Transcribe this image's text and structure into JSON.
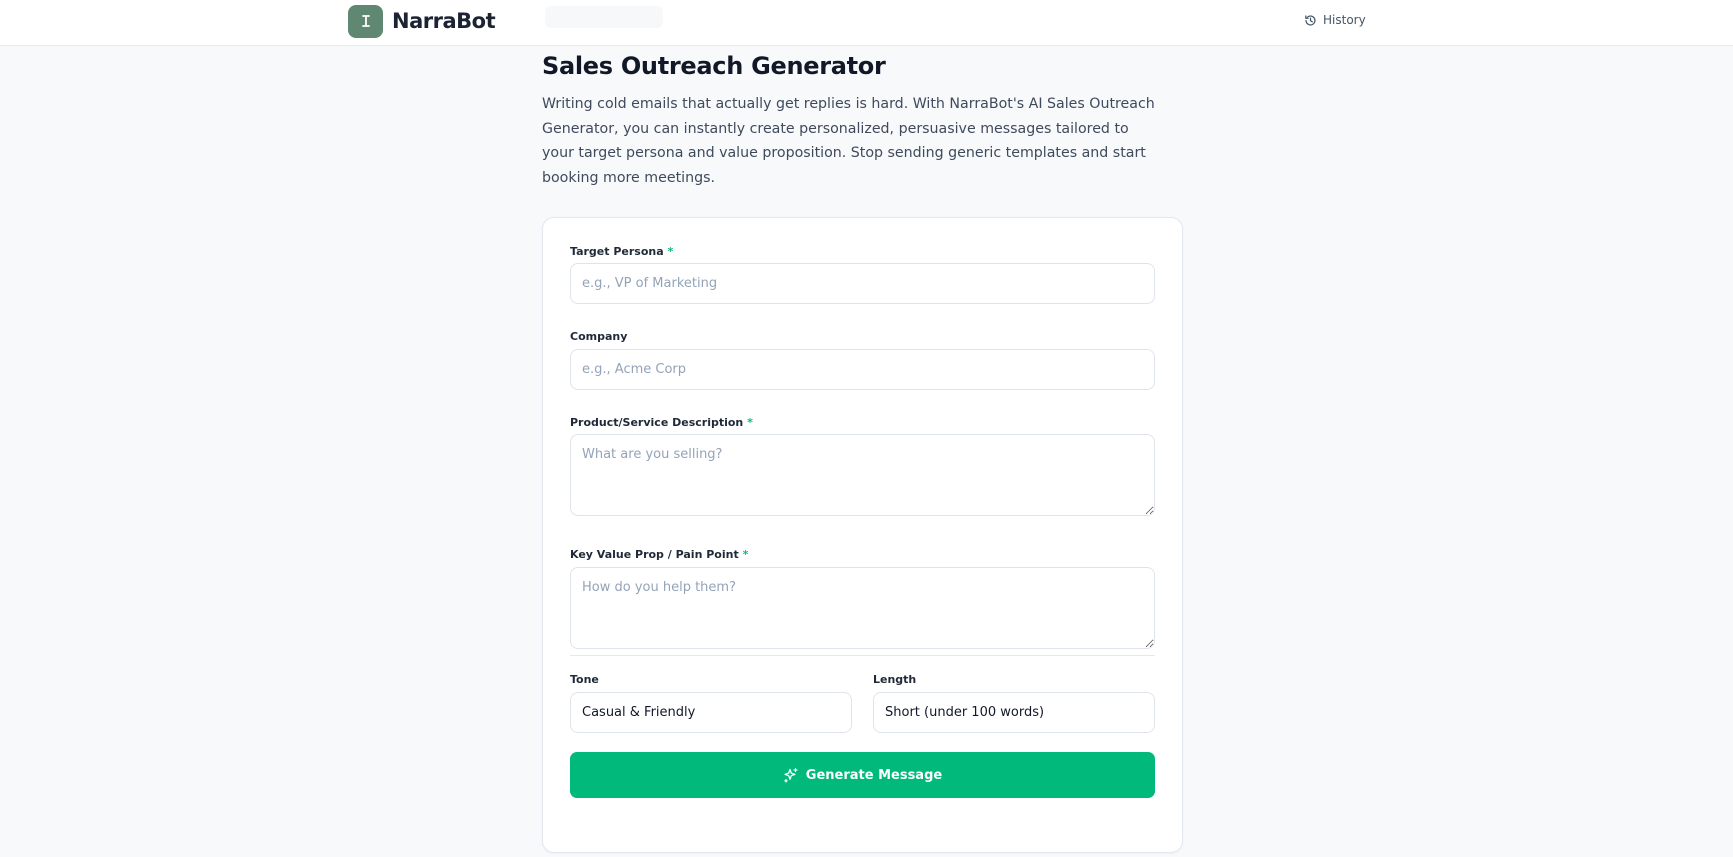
{
  "header": {
    "brand_name": "NarraBot",
    "history_label": "History"
  },
  "page": {
    "title": "Sales Outreach Generator",
    "intro": "Writing cold emails that actually get replies is hard. With NarraBot's AI Sales Outreach Generator, you can instantly create personalized, persuasive messages tailored to your target persona and value proposition. Stop sending generic templates and start booking more meetings."
  },
  "form": {
    "persona": {
      "label": "Target Persona",
      "required_mark": "*",
      "placeholder": "e.g., VP of Marketing",
      "value": ""
    },
    "company": {
      "label": "Company",
      "placeholder": "e.g., Acme Corp",
      "value": ""
    },
    "product": {
      "label": "Product/Service Description",
      "required_mark": "*",
      "placeholder": "What are you selling?",
      "value": ""
    },
    "value_prop": {
      "label": "Key Value Prop / Pain Point",
      "required_mark": "*",
      "placeholder": "How do you help them?",
      "value": ""
    },
    "tone": {
      "label": "Tone",
      "value": "Casual & Friendly"
    },
    "length": {
      "label": "Length",
      "value": "Short (under 100 words)"
    },
    "generate_label": "Generate Message"
  },
  "colors": {
    "accent": "#00b97a",
    "logo_bg": "#5f8772",
    "required": "#10b981"
  },
  "icons": {
    "logo": "text-cursor-icon",
    "history": "history-icon",
    "generate": "sparkles-icon"
  }
}
